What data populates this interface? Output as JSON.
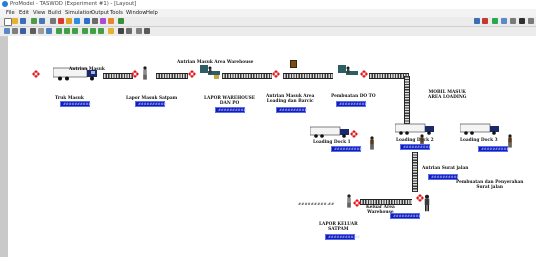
{
  "window": {
    "title": "ProModel - TASWOD (Experiment #1) - [Layout]"
  },
  "menu": [
    "File",
    "Edit",
    "View",
    "Build",
    "Simulation",
    "Output",
    "Tools",
    "Window",
    "Help"
  ],
  "counters": {
    "truk_masuk": "##########",
    "lapor": "##########",
    "lapor_wh": "##########",
    "antrian_loading": "##########",
    "pembuatan_do": "##########",
    "dock1": "##########",
    "dock2": "##########",
    "dock3": "##########",
    "surat_jalan": "##########",
    "keluar": "##########",
    "exit_count": "#########.##"
  },
  "labels": {
    "antrian_masuk": "Antrian Masuk",
    "antrian_masuk_area": "Antrian Masuk\nArea Warehouse",
    "truk_masuk": "Truk Masuk",
    "lapor_masuk": "Lapor Masuk Satpam",
    "lapor_wh": "LAPOR WAREHOUSE\nDAN PO",
    "antrian_loading": "Antrian Masuk Area\nLoading dan Barcic",
    "pembuatan_do": "Pembuatan DO TO",
    "mobil_masuk": "MOBIL MASUK\nAREA LOADING",
    "dock1": "Loading Dock 1",
    "dock2": "Loading Dock 2",
    "dock3": "Loading Dock 3",
    "antrian_surat": "Antrian Surat jalan",
    "pembuatan_surat": "Pembuatan dan Penyerahan\nSurat jalan",
    "keluar_area": "Keluar Area\nWarehouse",
    "lapor_keluar": "LAPOR KELUAR\nSATPAM"
  },
  "colors": {
    "truck_cab": "#1b2a6b",
    "counter_bg": "#0f1cb8",
    "blocked": "#e5141b"
  }
}
